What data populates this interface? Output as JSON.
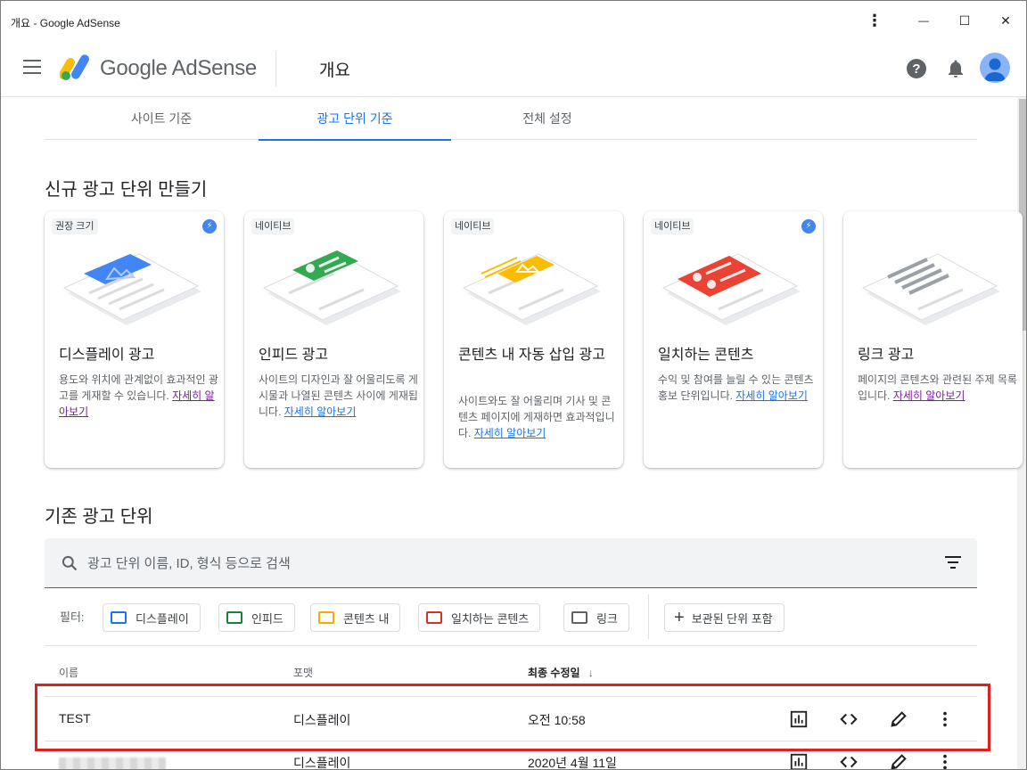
{
  "window": {
    "title": "개요 - Google AdSense",
    "menu_glyph": "⋮",
    "minimize_glyph": "—",
    "maximize_glyph": "☐",
    "close_glyph": "✕"
  },
  "header": {
    "brand": "Google AdSense",
    "page_title": "개요",
    "help_icon": "help-icon",
    "notifications_icon": "bell-icon"
  },
  "tabs": [
    {
      "label": "사이트 기준",
      "active": false
    },
    {
      "label": "광고 단위 기준",
      "active": true
    },
    {
      "label": "전체 설정",
      "active": false
    }
  ],
  "create_section": {
    "title": "신규 광고 단위 만들기",
    "cards": [
      {
        "badge": "권장 크기",
        "bolt": true,
        "title": "디스플레이 광고",
        "desc": "용도와 위치에 관계없이 효과적인 광고를 게재할 수 있습니다.",
        "link": "자세히 알아보기",
        "color": "#4285f4"
      },
      {
        "badge": "네이티브",
        "bolt": false,
        "title": "인피드 광고",
        "desc": "사이트의 디자인과 잘 어울리도록 게시물과 나열된 콘텐츠 사이에 게재됩니다.",
        "link": "자세히 알아보기",
        "color": "#34a853"
      },
      {
        "badge": "네이티브",
        "bolt": false,
        "title": "콘텐츠 내 자동 삽입 광고",
        "desc": "사이트와도 잘 어울리며 기사 및 콘텐츠 페이지에 게재하면 효과적입니다.",
        "link": "자세히 알아보기",
        "color": "#fbbc04"
      },
      {
        "badge": "네이티브",
        "bolt": true,
        "title": "일치하는 콘텐츠",
        "desc": "수익 및 참여를 늘릴 수 있는 콘텐츠 홍보 단위입니다.",
        "link": "자세히 알아보기",
        "color": "#ea4335"
      },
      {
        "badge": "",
        "bolt": false,
        "title": "링크 광고",
        "desc": "페이지의 콘텐츠와 관련된 주제 목록입니다.",
        "link": "자세히 알아보기",
        "color": "#9aa0a6"
      }
    ],
    "bolt_glyph": "⚡"
  },
  "existing_section": {
    "title": "기존 광고 단위",
    "search_placeholder": "광고 단위 이름, ID, 형식 등으로 검색",
    "filter_label": "필터:",
    "filters": [
      {
        "label": "디스플레이",
        "color": "#1a73e8"
      },
      {
        "label": "인피드",
        "color": "#188038"
      },
      {
        "label": "콘텐츠 내",
        "color": "#f9ab00"
      },
      {
        "label": "일치하는 콘텐츠",
        "color": "#d93025"
      },
      {
        "label": "링크",
        "color": "#5f6368"
      }
    ],
    "archived_label": "보관된 단위 포함",
    "archived_glyph": "+",
    "columns": {
      "name": "이름",
      "format": "포맷",
      "modified": "최종 수정일",
      "sort_glyph": "↓"
    },
    "rows": [
      {
        "name": "TEST",
        "format": "디스플레이",
        "modified": "오전 10:58"
      },
      {
        "name": "",
        "format": "디스플레이",
        "modified": "2020년 4월 11일"
      }
    ]
  }
}
